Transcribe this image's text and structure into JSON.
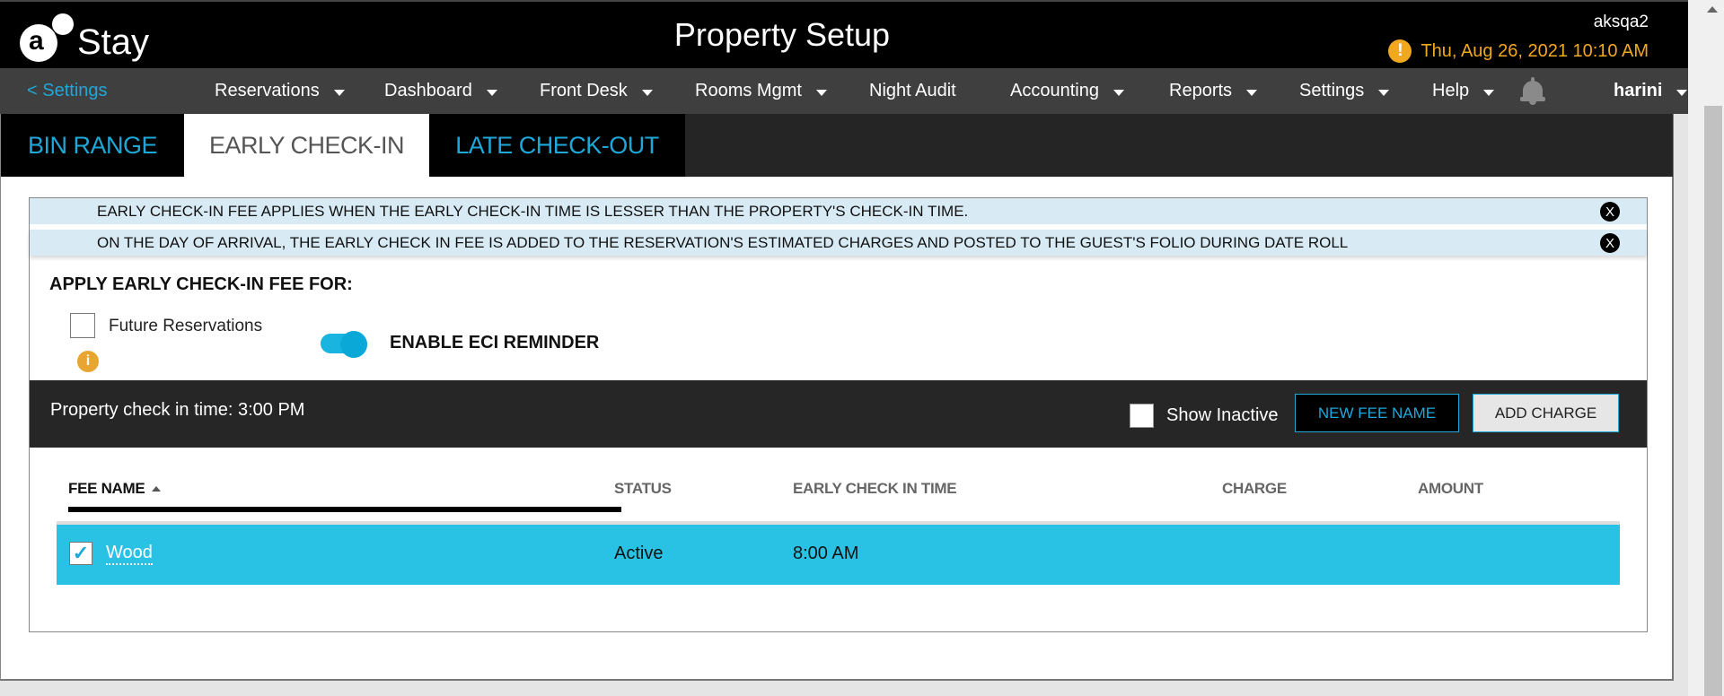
{
  "header": {
    "brand": "Stay",
    "title": "Property Setup",
    "property_code": "aksqa2",
    "datetime": "Thu, Aug 26, 2021 10:10 AM",
    "warning_icon": "exclamation-circle-icon"
  },
  "nav": {
    "back_label": "< Settings",
    "items": [
      {
        "label": "Reservations",
        "dropdown": true
      },
      {
        "label": "Dashboard",
        "dropdown": true
      },
      {
        "label": "Front Desk",
        "dropdown": true
      },
      {
        "label": "Rooms Mgmt",
        "dropdown": true
      },
      {
        "label": "Night Audit",
        "dropdown": false
      },
      {
        "label": "Accounting",
        "dropdown": true
      },
      {
        "label": "Reports",
        "dropdown": true
      },
      {
        "label": "Settings",
        "dropdown": true
      },
      {
        "label": "Help",
        "dropdown": true
      }
    ],
    "notification_icon": "bell-icon",
    "user": "harini"
  },
  "tabs": [
    {
      "label": "BIN RANGE",
      "active": false
    },
    {
      "label": "EARLY CHECK-IN",
      "active": true
    },
    {
      "label": "LATE CHECK-OUT",
      "active": false
    }
  ],
  "notices": [
    "EARLY CHECK-IN FEE APPLIES WHEN THE EARLY CHECK-IN TIME IS LESSER THAN THE PROPERTY'S CHECK-IN TIME.",
    "ON THE DAY OF ARRIVAL, THE EARLY CHECK IN FEE IS ADDED TO THE RESERVATION'S ESTIMATED CHARGES AND POSTED TO THE GUEST'S FOLIO DURING DATE ROLL"
  ],
  "close_glyph": "X",
  "apply": {
    "heading": "APPLY EARLY CHECK-IN FEE FOR:",
    "future_reservations_label": "Future Reservations",
    "future_reservations_checked": false,
    "info_glyph": "i",
    "eci_reminder_label": "ENABLE ECI REMINDER",
    "eci_reminder_enabled": true
  },
  "toolbar": {
    "checkin_time": "Property check in time: 3:00 PM",
    "show_inactive_label": "Show Inactive",
    "show_inactive_checked": false,
    "new_fee_label": "NEW FEE NAME",
    "add_charge_label": "ADD CHARGE"
  },
  "table": {
    "columns": [
      "FEE NAME",
      "STATUS",
      "EARLY CHECK IN TIME",
      "CHARGE",
      "AMOUNT"
    ],
    "sort_column": "FEE NAME",
    "sort_direction": "asc",
    "rows": [
      {
        "checked": true,
        "fee_name": "Wood",
        "status": "Active",
        "early_check_in_time": "8:00 AM",
        "charge": "",
        "amount": ""
      }
    ]
  },
  "colors": {
    "accent": "#1ea8d8",
    "selected_row": "#29c2e4",
    "warning": "#f0a81e",
    "notice_bg": "#d8eaf4"
  }
}
